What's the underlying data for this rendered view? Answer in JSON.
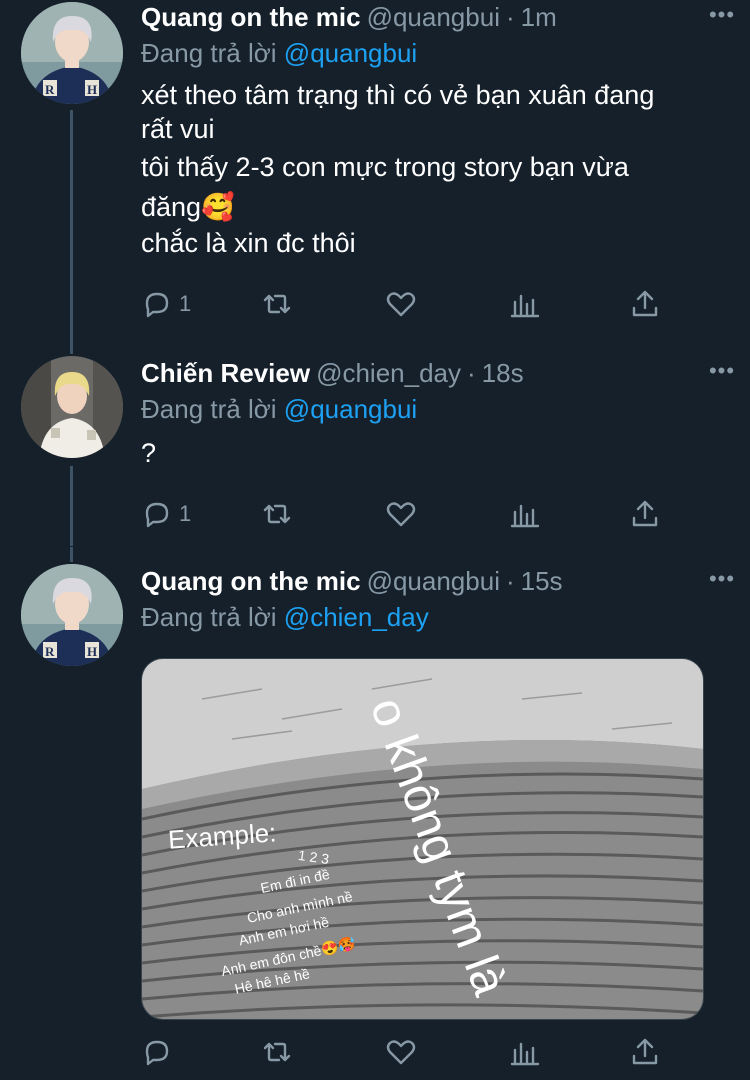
{
  "tweets": [
    {
      "name": "Quang on the mic",
      "handle": "@quangbui",
      "time": "1m",
      "replying_prefix": "Đang trả lời",
      "replying_to": "@quangbui",
      "lines": [
        "xét theo tâm trạng thì có vẻ bạn xuân đang",
        "rất vui",
        "tôi thấy 2-3 con mực trong story bạn vừa",
        "đăng🥰",
        "chắc là xin đc thôi"
      ],
      "reply_count": "1",
      "more": "•••"
    },
    {
      "name": "Chiến Review",
      "handle": "@chien_day",
      "time": "18s",
      "replying_prefix": "Đang trả lời",
      "replying_to": "@quangbui",
      "lines": [
        "?"
      ],
      "reply_count": "1",
      "more": "•••"
    },
    {
      "name": "Quang on the mic",
      "handle": "@quangbui",
      "time": "15s",
      "replying_prefix": "Đang trả lời",
      "replying_to": "@chien_day",
      "more": "•••",
      "image": {
        "example_label": "Example:",
        "numbers": "1 2 3",
        "poem": [
          "Em đi in đề",
          "Cho anh mình nề",
          "Anh em hơi hề",
          "Anh em đôn chề😍🥵",
          "Hê hê hê hề"
        ],
        "big_caption": "o không tym là"
      }
    }
  ],
  "dot": "·"
}
